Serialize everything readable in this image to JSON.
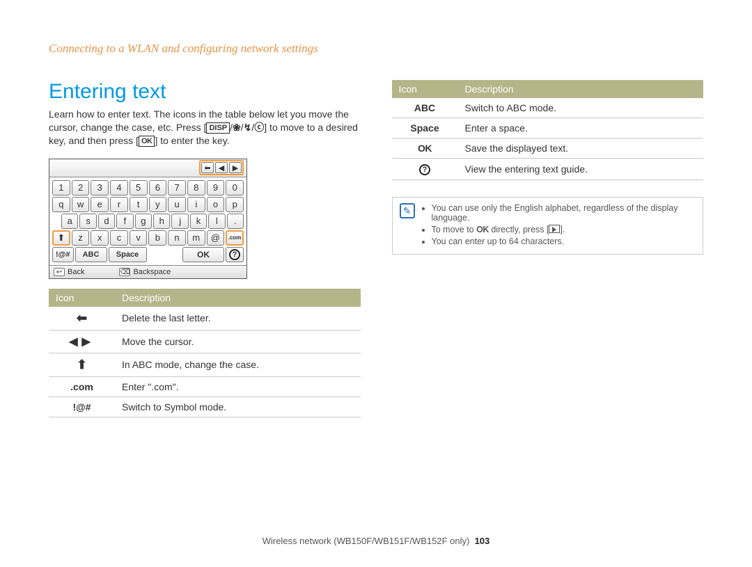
{
  "breadcrumb": "Connecting to a WLAN and configuring network settings",
  "heading": "Entering text",
  "intro": {
    "p1": "Learn how to enter text. The icons in the table below let you move the cursor, change the case, etc. Press [",
    "disp": "DISP",
    "p2": "/",
    "p3": "/",
    "p4": "/",
    "p5": "] to move to a desired key, and then press [",
    "ok": "OK",
    "p6": "] to enter the key."
  },
  "keyboard": {
    "nav": [
      "⬅",
      "◀",
      "▶"
    ],
    "row1": [
      "1",
      "2",
      "3",
      "4",
      "5",
      "6",
      "7",
      "8",
      "9",
      "0"
    ],
    "row2": [
      "q",
      "w",
      "e",
      "r",
      "t",
      "y",
      "u",
      "i",
      "o",
      "p"
    ],
    "row3": [
      "a",
      "s",
      "d",
      "f",
      "g",
      "h",
      "j",
      "k",
      "l",
      "."
    ],
    "row4_shift": "⬆",
    "row4": [
      "z",
      "x",
      "c",
      "v",
      "b",
      "n",
      "m",
      "@"
    ],
    "row4_com": ".com",
    "row5": {
      "sym": "!@#",
      "abc": "ABC",
      "space": "Space",
      "ok": "OK",
      "info": "?"
    },
    "footer": {
      "back_sym": "↩",
      "back": "Back",
      "bksp_sym": "⌫",
      "backspace": "Backspace"
    }
  },
  "table1": {
    "h_icon": "Icon",
    "h_desc": "Description",
    "rows": [
      {
        "desc": "Delete the last letter."
      },
      {
        "desc": "Move the cursor."
      },
      {
        "desc": "In ABC mode, change the case."
      },
      {
        "icon": ".com",
        "desc": "Enter \".com\"."
      },
      {
        "icon": "!@#",
        "desc": "Switch to Symbol mode."
      }
    ]
  },
  "table2": {
    "h_icon": "Icon",
    "h_desc": "Description",
    "rows": [
      {
        "icon": "ABC",
        "desc": "Switch to ABC mode."
      },
      {
        "icon": "Space",
        "desc": "Enter a space."
      },
      {
        "icon": "OK",
        "desc": "Save the displayed text."
      },
      {
        "desc": "View the entering text guide."
      }
    ]
  },
  "notes": {
    "n1": "You can use only the English alphabet, regardless of the display language.",
    "n2a": "To move to ",
    "n2_ok": "OK",
    "n2b": " directly, press [",
    "n2c": "].",
    "n3": "You can enter up to 64 characters."
  },
  "footer": {
    "text": "Wireless network (WB150F/WB151F/WB152F only)",
    "page": "103"
  }
}
